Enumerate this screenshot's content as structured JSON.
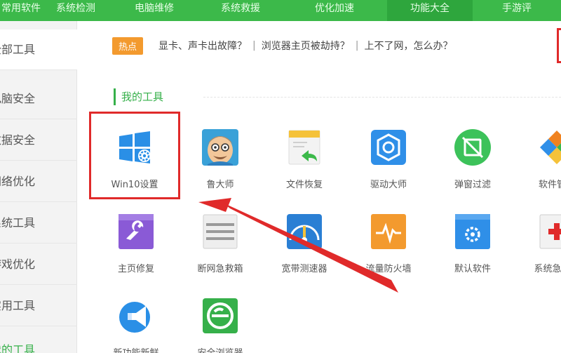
{
  "topnav": {
    "items": [
      {
        "label": "常用软件"
      },
      {
        "label": "系统检测"
      },
      {
        "label": "电脑维修"
      },
      {
        "label": "系统救援"
      },
      {
        "label": "优化加速"
      },
      {
        "label": "功能大全"
      },
      {
        "label": "手游评"
      }
    ]
  },
  "sidebar": {
    "items": [
      {
        "label": "全部工具"
      },
      {
        "label": "电脑安全"
      },
      {
        "label": "数据安全"
      },
      {
        "label": "网络优化"
      },
      {
        "label": "系统工具"
      },
      {
        "label": "游戏优化"
      },
      {
        "label": "实用工具"
      },
      {
        "label": "我的工具"
      }
    ]
  },
  "hot": {
    "badge": "热点",
    "links": [
      {
        "text": "显卡、声卡出故障？"
      },
      {
        "text": "浏览器主页被劫持？"
      },
      {
        "text": "上不了网，怎么办？"
      }
    ],
    "separator": "|"
  },
  "section": {
    "title": "我的工具"
  },
  "tools": [
    {
      "label": "Win10设置",
      "icon": "windows-settings-icon",
      "color": "#2a8fe6"
    },
    {
      "label": "鲁大师",
      "icon": "ludashi-face-icon",
      "color": "#3aa1d8"
    },
    {
      "label": "文件恢复",
      "icon": "file-restore-icon",
      "color": "#f5c23a"
    },
    {
      "label": "驱动大师",
      "icon": "driver-gear-icon",
      "color": "#2f8fe8"
    },
    {
      "label": "弹窗过滤",
      "icon": "popup-filter-icon",
      "color": "#3cc25a"
    },
    {
      "label": "软件管家",
      "icon": "software-manager-icon",
      "color": "#f0821f"
    },
    {
      "label": "主页修复",
      "icon": "homepage-repair-icon",
      "color": "#8a5ad6"
    },
    {
      "label": "断网急救箱",
      "icon": "network-firstaid-icon",
      "color": "#8a8a8a"
    },
    {
      "label": "宽带测速器",
      "icon": "speed-test-icon",
      "color": "#2a7fd4"
    },
    {
      "label": "流量防火墙",
      "icon": "traffic-firewall-icon",
      "color": "#f39a2e"
    },
    {
      "label": "默认软件",
      "icon": "default-software-icon",
      "color": "#2f8fe8"
    },
    {
      "label": "系统急救箱",
      "icon": "system-firstaid-icon",
      "color": "#e02a2a"
    },
    {
      "label": "新功能新鲜",
      "icon": "announce-icon",
      "color": "#2a8fe6"
    },
    {
      "label": "安全浏览器",
      "icon": "safe-browser-icon",
      "color": "#36b04a"
    }
  ],
  "colors": {
    "brand_green": "#3cb94a",
    "highlight_red": "#e02a2a",
    "badge_orange": "#f39a2e"
  }
}
